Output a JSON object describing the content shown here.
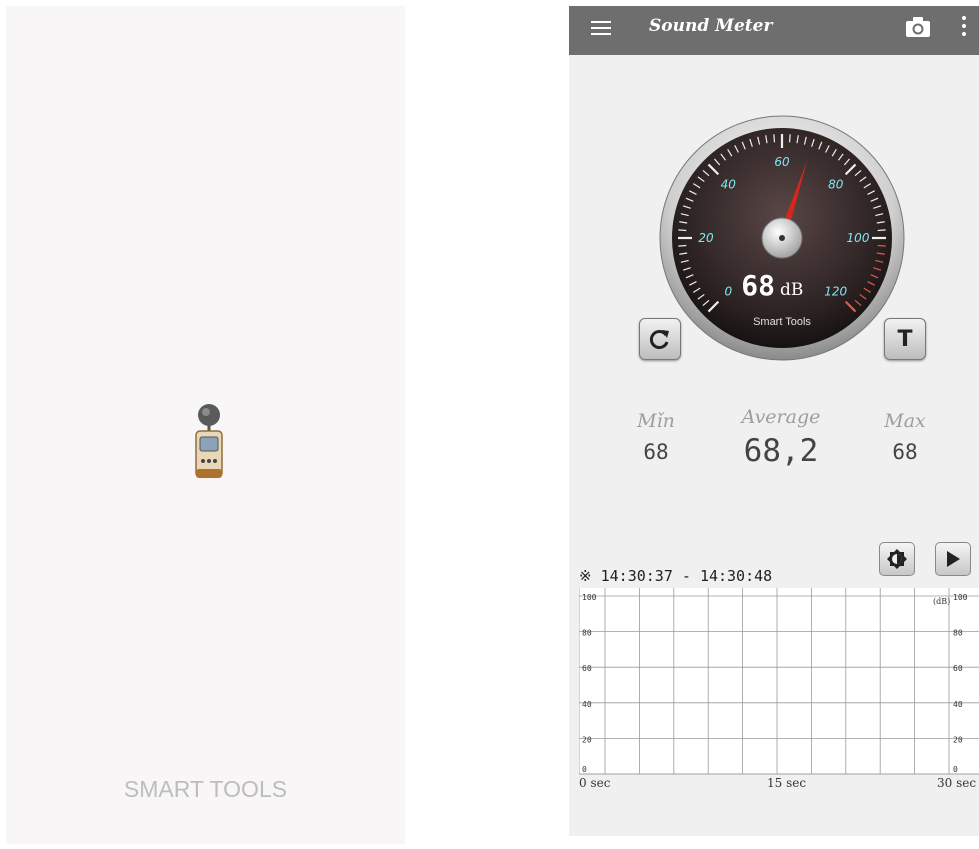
{
  "splash": {
    "brand": "SMART TOOLS"
  },
  "app": {
    "title": "Sound Meter",
    "icons": {
      "menu": "hamburger-menu-icon",
      "camera": "camera-icon",
      "more": "more-vertical-icon"
    },
    "gauge": {
      "value": 68,
      "reading": "68",
      "unit": "dB",
      "brand": "Smart Tools",
      "min": 0,
      "max": 120,
      "ticks": [
        "0",
        "20",
        "40",
        "60",
        "80",
        "100",
        "120"
      ]
    },
    "buttons": {
      "reset": "C",
      "timer": "T"
    },
    "stats": {
      "min_label": "Mǐn",
      "min_value": "68",
      "avg_label": "Average",
      "avg_value": "68,2",
      "max_label": "Max",
      "max_value": "68"
    },
    "graph": {
      "range": "※ 14:30:37 - 14:30:48",
      "unit": "(dB)",
      "y_ticks": [
        "100",
        "80",
        "60",
        "40",
        "20",
        "0"
      ],
      "x_ticks": [
        "0 sec",
        "15 sec",
        "30 sec"
      ]
    }
  }
}
